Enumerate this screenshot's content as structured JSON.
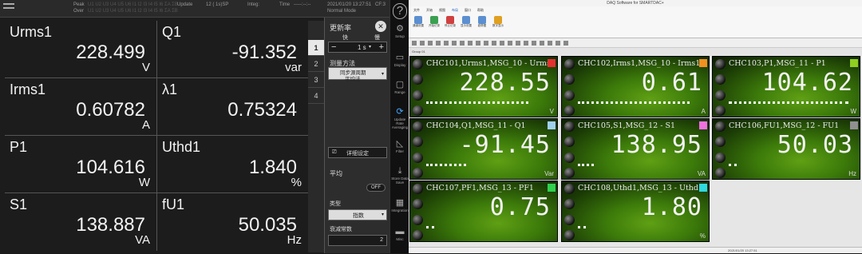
{
  "instrument": {
    "top": {
      "peak_label": "Peak",
      "over_label": "Over",
      "update_label": "Update",
      "update_value": "12 ( 1s)SP",
      "integ_label": "Integ:",
      "time_label": "Time",
      "time_value": "-----:--:--",
      "datetime": "2021/01/20 13:27:51",
      "cf": "CF:3",
      "mode": "Normal Mode"
    },
    "cells": [
      {
        "label": "Urms1",
        "value": "228.499",
        "unit": "V"
      },
      {
        "label": "Q1",
        "value": "-91.352",
        "unit": "var"
      },
      {
        "label": "Irms1",
        "value": "0.60782",
        "unit": "A"
      },
      {
        "label": "λ1",
        "value": "0.75324",
        "unit": ""
      },
      {
        "label": "P1",
        "value": "104.616",
        "unit": "W"
      },
      {
        "label": "Uthd1",
        "value": "1.840",
        "unit": "%"
      },
      {
        "label": "S1",
        "value": "138.887",
        "unit": "VA"
      },
      {
        "label": "fU1",
        "value": "50.035",
        "unit": "Hz"
      }
    ],
    "pages": [
      "1",
      "2",
      "3",
      "4"
    ],
    "panel": {
      "title": "更新率",
      "fast": "快",
      "slow": "慢",
      "rate_value": "1 s",
      "measure_method": "测量方法",
      "measure_value_1": "同步源周期",
      "measure_value_2": "平均法",
      "detail_settings": "详细设定",
      "average": "平均",
      "toggle": "OFF",
      "type_label": "类型",
      "type_value": "指数",
      "decay_label": "衰减常数",
      "decay_value": "2"
    },
    "side_menu": [
      {
        "icon": "?",
        "label": ""
      },
      {
        "icon": "⚙",
        "label": "Setup"
      },
      {
        "icon": "▭",
        "label": "Display"
      },
      {
        "icon": "▢",
        "label": "Range"
      },
      {
        "icon": "⟳",
        "label": "Update Rate Averaging"
      },
      {
        "icon": "◺",
        "label": "Filter"
      },
      {
        "icon": "⤓",
        "label": "Store Data Save"
      },
      {
        "icon": "▦",
        "label": "Integration"
      },
      {
        "icon": "▬",
        "label": "Misc"
      }
    ]
  },
  "app": {
    "title": "DAQ Software for SMARTDAC+",
    "ribbon_tabs": [
      "文件",
      "开始",
      "视图",
      "布局",
      "窗口",
      "帮助"
    ],
    "ribbon_buttons": [
      "通道设置",
      "开始记录",
      "停止记录",
      "显示设置",
      "趋势图",
      "数字显示",
      "报警",
      "数据列表",
      "棒图",
      "监控",
      "系统设置",
      "连接管理"
    ],
    "group_tab": "Group 01",
    "status_text": "2021/01/20 13:27:51",
    "tiles": [
      {
        "header": "CHC101,Urms1,MSG_10 - Urms1",
        "value": "228.55",
        "unit": "V",
        "color": "#e53030"
      },
      {
        "header": "CHC102,Irms1,MSG_10 - Irms1",
        "value": "0.61",
        "unit": "A",
        "color": "#f29020"
      },
      {
        "header": "CHC103,P1,MSG_11 - P1",
        "value": "104.62",
        "unit": "W",
        "color": "#8fd020"
      },
      {
        "header": "CHC104,Q1,MSG_11 - Q1",
        "value": "-91.45",
        "unit": "Var",
        "color": "#a0d0f0"
      },
      {
        "header": "CHC105,S1,MSG_12 - S1",
        "value": "138.95",
        "unit": "VA",
        "color": "#f070e0"
      },
      {
        "header": "CHC106,FU1,MSG_12 - FU1",
        "value": "50.03",
        "unit": "Hz",
        "color": "#909090"
      },
      {
        "header": "CHC107,PF1,MSG_13 - PF1",
        "value": "0.75",
        "unit": "",
        "color": "#30d050"
      },
      {
        "header": "CHC108,Uthd1,MSG_13 - Uthd1",
        "value": "1.80",
        "unit": "%",
        "color": "#30d8e0"
      }
    ]
  }
}
